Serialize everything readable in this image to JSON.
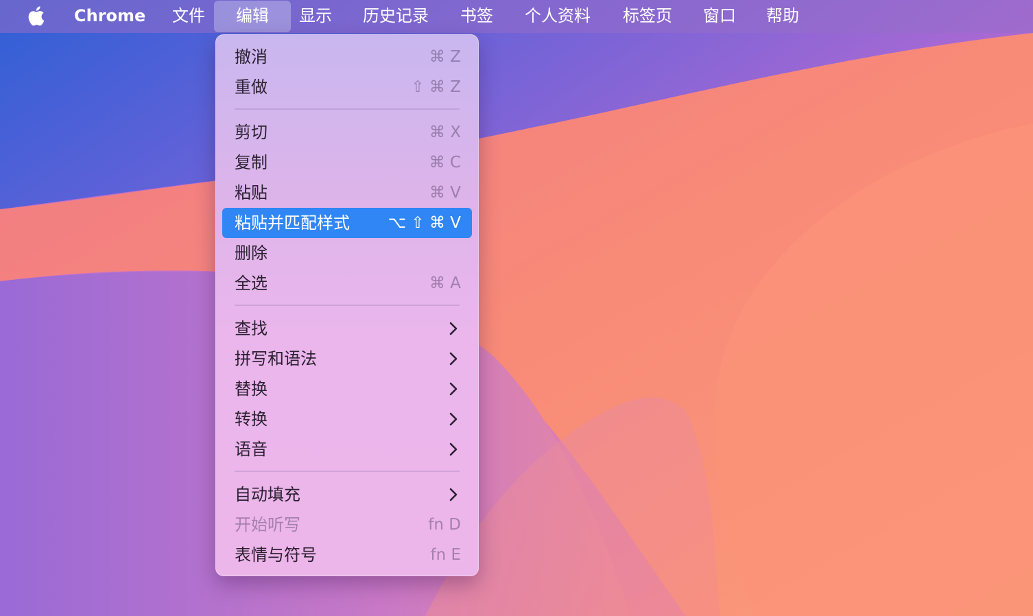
{
  "menubar": {
    "apple_icon": "apple-logo-icon",
    "app_name": "Chrome",
    "items": [
      "文件",
      "编辑",
      "显示",
      "历史记录",
      "书签",
      "个人资料",
      "标签页",
      "窗口",
      "帮助"
    ],
    "active_item": "编辑"
  },
  "edit_menu": {
    "undo": {
      "label": "撤消",
      "shortcut": "⌘ Z"
    },
    "redo": {
      "label": "重做",
      "shortcut": "⇧ ⌘ Z"
    },
    "cut": {
      "label": "剪切",
      "shortcut": "⌘ X"
    },
    "copy": {
      "label": "复制",
      "shortcut": "⌘ C"
    },
    "paste": {
      "label": "粘贴",
      "shortcut": "⌘ V"
    },
    "paste_match": {
      "label": "粘贴并匹配样式",
      "shortcut": "⌥ ⇧ ⌘ V",
      "highlighted": true
    },
    "delete": {
      "label": "删除"
    },
    "select_all": {
      "label": "全选",
      "shortcut": "⌘ A"
    },
    "find": {
      "label": "查找",
      "submenu_icon": "chevron-right-icon"
    },
    "spelling": {
      "label": "拼写和语法",
      "submenu_icon": "chevron-right-icon"
    },
    "substitutions": {
      "label": "替换",
      "submenu_icon": "chevron-right-icon"
    },
    "transformations": {
      "label": "转换",
      "submenu_icon": "chevron-right-icon"
    },
    "speech": {
      "label": "语音",
      "submenu_icon": "chevron-right-icon"
    },
    "autofill": {
      "label": "自动填充",
      "submenu_icon": "chevron-right-icon"
    },
    "dictation": {
      "label": "开始听写",
      "shortcut": "fn D",
      "disabled": true
    },
    "emoji": {
      "label": "表情与符号",
      "shortcut": "fn E"
    }
  },
  "colors": {
    "highlight": "#2f86f4",
    "wallpaper_blue": "#3a5fd0",
    "wallpaper_coral": "#f48a78",
    "wallpaper_purple": "#b06ad0"
  }
}
